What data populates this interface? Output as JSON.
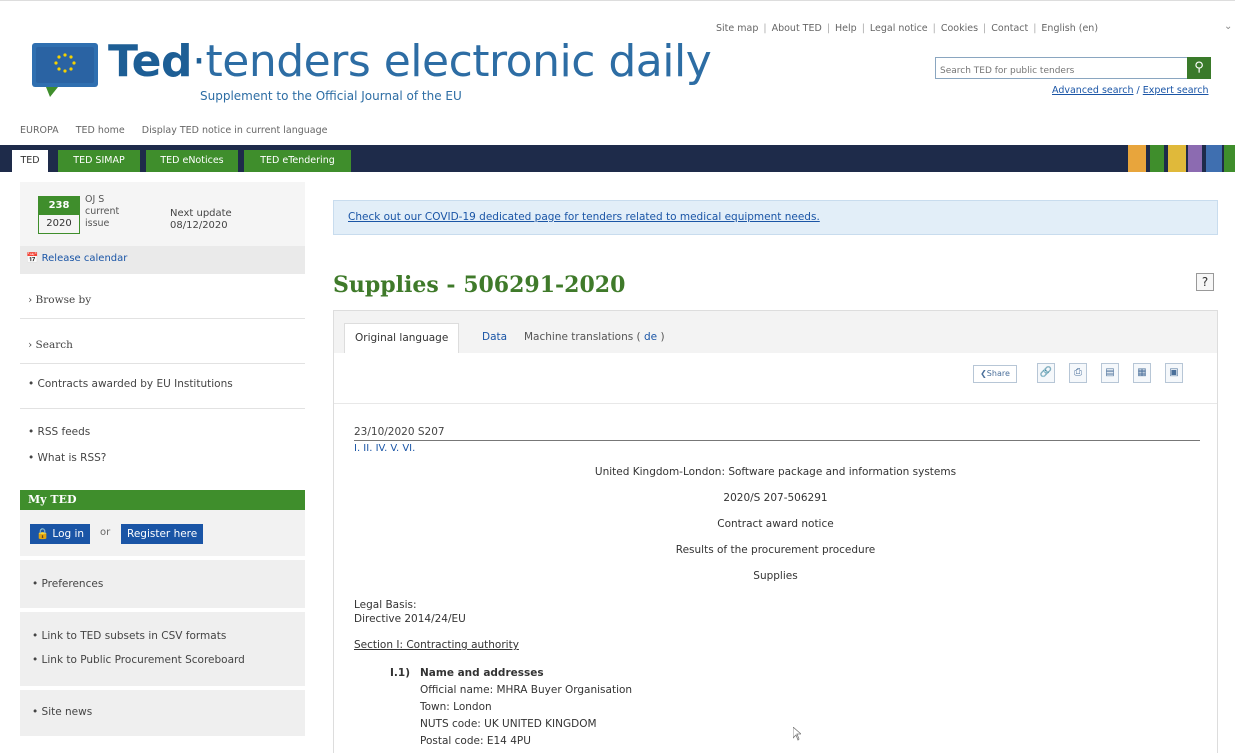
{
  "header": {
    "logo_ted": "Ted",
    "logo_dot": "·",
    "logo_rest": "tenders electronic daily",
    "logo_sub": "Supplement to the Official Journal of the EU",
    "top_links": [
      "Site map",
      "About TED",
      "Help",
      "Legal notice",
      "Cookies",
      "Contact",
      "English (en)"
    ],
    "search_placeholder": "Search TED for public tenders",
    "advanced_search": "Advanced search",
    "expert_search": "Expert search"
  },
  "breadcrumbs": [
    "EUROPA",
    "TED home",
    "Display TED notice in current language"
  ],
  "tabs": [
    "TED",
    "TED SIMAP",
    "TED eNotices",
    "TED eTendering"
  ],
  "sidebar": {
    "ojs_number": "238",
    "ojs_year": "2020",
    "ojs_label": "OJ S current issue",
    "next_update_label": "Next update",
    "next_update_date": "08/12/2020",
    "release_calendar": "Release calendar",
    "browse_by": "Browse by",
    "search": "Search",
    "contracts_eu": "Contracts awarded by EU Institutions",
    "rss_feeds": "RSS feeds",
    "what_is_rss": "What is RSS?",
    "my_ted": "My TED",
    "log_in": "Log in",
    "or": "or",
    "register": "Register here",
    "preferences": "Preferences",
    "csv_link": "Link to TED subsets in CSV formats",
    "scoreboard_link": "Link to Public Procurement Scoreboard",
    "site_news": "Site news"
  },
  "main": {
    "covid_link": "Check out our COVID-19 dedicated page for tenders related to medical equipment needs.",
    "page_title": "Supplies - 506291-2020",
    "help": "?",
    "notice_tabs": {
      "original": "Original language",
      "data": "Data",
      "mt_prefix": "Machine translations (",
      "mt_lang": "de",
      "mt_suffix": ")"
    },
    "share": "Share",
    "date_ref": "23/10/2020    S207",
    "sections": "I.  II.  IV.  V.  VI.",
    "location_title": "United Kingdom-London: Software package and information systems",
    "notice_number": "2020/S 207-506291",
    "notice_type": "Contract award notice",
    "results": "Results of the procurement procedure",
    "supplies": "Supplies",
    "legal_basis_label": "Legal Basis:",
    "legal_basis_value": "Directive 2014/24/EU",
    "section_i": "Section I: Contracting authority",
    "i1_number": "I.1)",
    "i1_title": "Name and addresses",
    "official_name": "Official name: MHRA Buyer Organisation",
    "town": "Town: London",
    "nuts": "NUTS code: UK UNITED KINGDOM",
    "postal": "Postal code: E14 4PU"
  },
  "colors": {
    "brand_blue": "#2d6da4",
    "ted_green": "#3f8e2c",
    "nav_dark": "#1e2b4a",
    "link_blue": "#1a55a6"
  }
}
